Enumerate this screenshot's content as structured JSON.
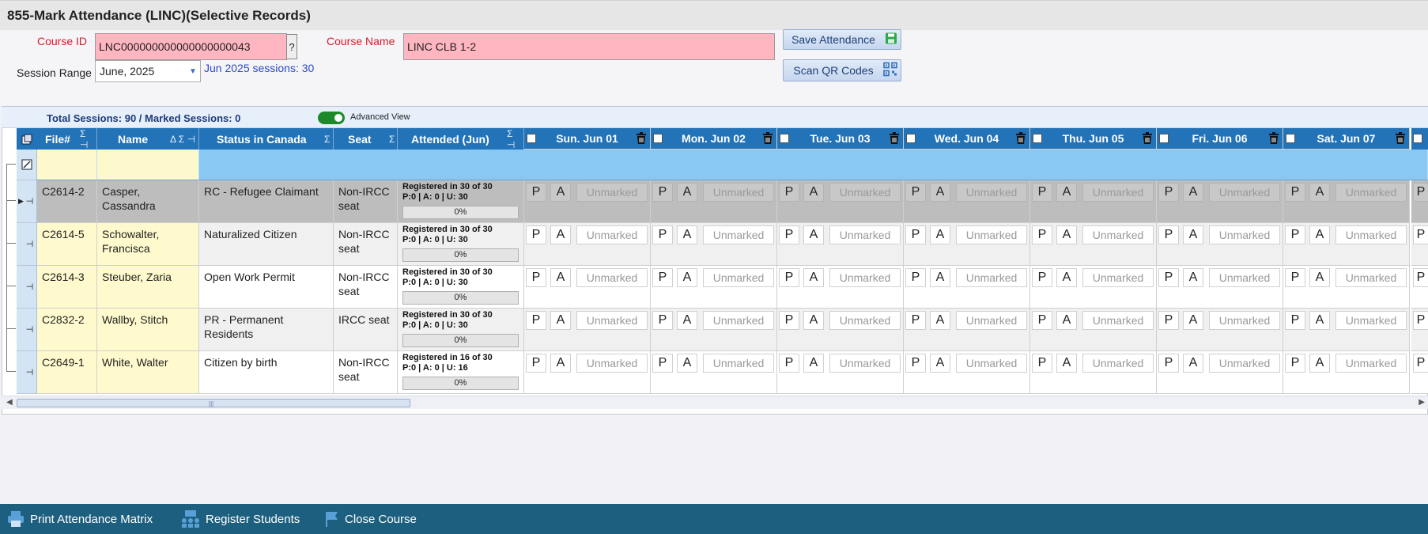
{
  "window": {
    "title": "855-Mark Attendance (LINC)(Selective Records)"
  },
  "form": {
    "course_id_label": "Course ID",
    "course_id_value": "LNC000000000000000000043",
    "course_id_lookup": "?",
    "course_name_label": "Course Name",
    "course_name_value": "LINC CLB 1-2",
    "session_range_label": "Session Range",
    "session_range_value": "June, 2025",
    "sessions_link": "Jun 2025 sessions: 30",
    "save_label": "Save Attendance",
    "scan_label": "Scan QR Codes"
  },
  "summary": {
    "total_text": "Total Sessions: 90 / Marked Sessions: 0",
    "advanced_view_label": "Advanced View",
    "advanced_view_on": true
  },
  "columns": {
    "file": "File#",
    "name": "Name",
    "status": "Status in Canada",
    "seat": "Seat",
    "attended": "Attended (Jun)",
    "days": [
      "Sun. Jun 01",
      "Mon. Jun 02",
      "Tue. Jun 03",
      "Wed. Jun 04",
      "Thu. Jun 05",
      "Fri. Jun 06",
      "Sat. Jun 07"
    ]
  },
  "mark_labels": {
    "present": "P",
    "absent": "A",
    "unmarked": "Unmarked"
  },
  "rows": [
    {
      "file": "C2614-2",
      "name": "Casper, Cassandra",
      "status": "RC - Refugee Claimant",
      "seat": "Non-IRCC seat",
      "reg": "Registered in 30 of 30",
      "counts": "P:0 | A: 0 | U: 30",
      "pct": "0%"
    },
    {
      "file": "C2614-5",
      "name": "Schowalter, Francisca",
      "status": "Naturalized Citizen",
      "seat": "Non-IRCC seat",
      "reg": "Registered in 30 of 30",
      "counts": "P:0 | A: 0 | U: 30",
      "pct": "0%"
    },
    {
      "file": "C2614-3",
      "name": "Steuber, Zaria",
      "status": "Open Work Permit",
      "seat": "Non-IRCC seat",
      "reg": "Registered in 30 of 30",
      "counts": "P:0 | A: 0 | U: 30",
      "pct": "0%"
    },
    {
      "file": "C2832-2",
      "name": "Wallby, Stitch",
      "status": "PR - Permanent Residents",
      "seat": "IRCC seat",
      "reg": "Registered in 30 of 30",
      "counts": "P:0 | A: 0 | U: 30",
      "pct": "0%"
    },
    {
      "file": "C2649-1",
      "name": "White, Walter",
      "status": "Citizen by birth",
      "seat": "Non-IRCC seat",
      "reg": "Registered in 16 of 30",
      "counts": "P:0 | A: 0 | U: 16",
      "pct": "0%"
    }
  ],
  "bottom": {
    "print_label": "Print Attendance Matrix",
    "register_label": "Register Students",
    "close_label": "Close Course"
  },
  "colors": {
    "header_blue": "#2273b8",
    "field_pink": "#ffb6c1",
    "bottom_bar": "#1d5f7e",
    "name_yellow": "#fefacd"
  }
}
